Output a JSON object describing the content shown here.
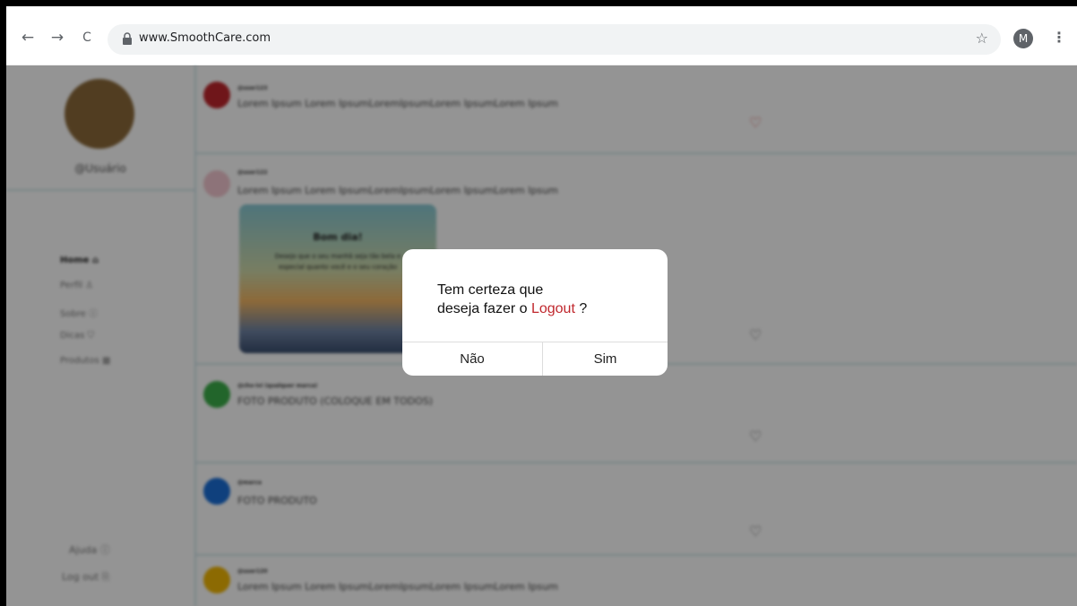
{
  "browser": {
    "url": "www.SmoothCare.com",
    "profile_initial": "M",
    "back_icon": "←",
    "forward_icon": "→",
    "reload_icon": "C",
    "star_icon": "☆",
    "menu_icon": "⋮"
  },
  "sidebar": {
    "username": "@Usuário",
    "items": [
      {
        "label": "Home",
        "icon": "home-icon"
      },
      {
        "label": "Perfil",
        "icon": "person-icon"
      },
      {
        "label": "Sobre",
        "icon": "info-icon"
      },
      {
        "label": "Dicas",
        "icon": "shield-icon"
      },
      {
        "label": "Produtos",
        "icon": "store-icon"
      }
    ],
    "help_label": "Ajuda",
    "logout_label": "Log out"
  },
  "feed": {
    "posts": [
      {
        "handle": "@user123",
        "text": "Lorem Ipsum Lorem IpsumLoremIpsumLorem IpsumLorem Ipsum",
        "avatar_color": "#c0272d"
      },
      {
        "handle": "@user122",
        "text": "Lorem Ipsum Lorem IpsumLoremIpsumLorem IpsumLorem Ipsum",
        "avatar_color": "#f3c7d0",
        "image": {
          "title": "Bom dia!",
          "text": "Desejo que o seu manhã seja tão bela e especial quanto você e o seu coração"
        }
      },
      {
        "handle": "@cho-ivi (qualquer marca)",
        "text": "FOTO PRODUTO (COLOQUE EM TODOS)",
        "avatar_color": "#3cae4a"
      },
      {
        "handle": "@marca",
        "text": "FOTO PRODUTO",
        "avatar_color": "#1a6fd8"
      },
      {
        "handle": "@user120",
        "text": "Lorem Ipsum Lorem IpsumLoremIpsumLorem IpsumLorem Ipsum",
        "avatar_color": "#f2b705"
      }
    ]
  },
  "dialog": {
    "message_line1": "Tem certeza que",
    "message_line2_prefix": "deseja fazer o ",
    "message_highlight": "Logout",
    "message_suffix": " ?",
    "cancel_label": "Não",
    "confirm_label": "Sim",
    "highlight_color": "#c0272d"
  }
}
